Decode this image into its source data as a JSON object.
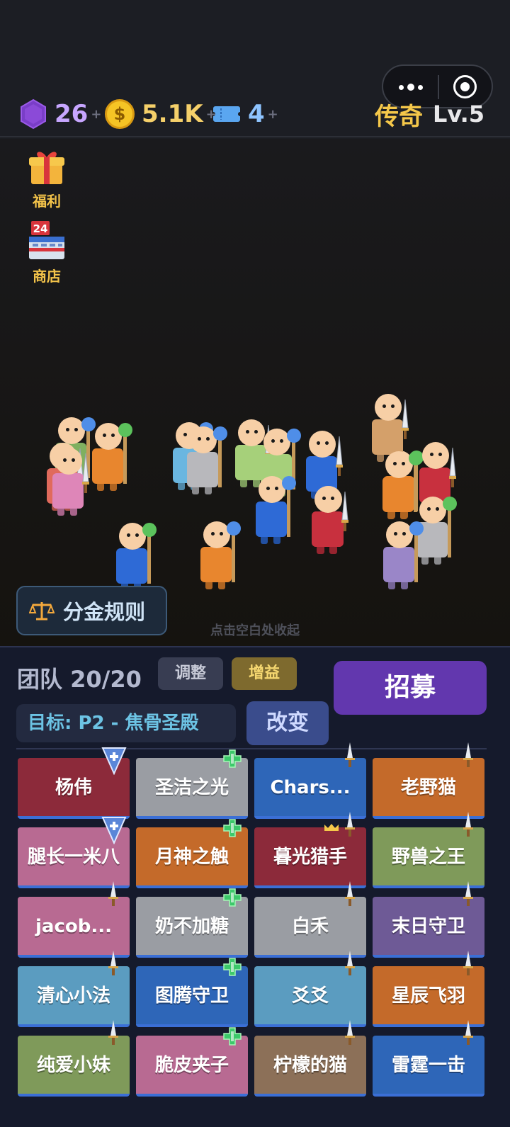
{
  "resources": {
    "gems": "26",
    "gold": "5.1K",
    "tickets": "4",
    "plus": "+"
  },
  "rank": {
    "name": "传奇",
    "level": "Lv.5"
  },
  "capsule": {
    "more_icon": "more-dots-icon",
    "close_icon": "target-circle-icon"
  },
  "side_buttons": {
    "welfare": "福利",
    "shop": "商店",
    "shop_badge": "24"
  },
  "rules_button": "分金规则",
  "hint": "点击空白处收起",
  "team": {
    "title": "团队 20/20",
    "adjust": "调整",
    "buff": "增益",
    "recruit": "招募",
    "target": "目标: P2 - 焦骨圣殿",
    "change": "改变"
  },
  "colors": {
    "red": "#8c2a3a",
    "gray": "#9a9da3",
    "blue": "#2e66b8",
    "orange": "#c46a2a",
    "pink": "#b86a92",
    "green": "#7f9a5a",
    "purple": "#6e5a96",
    "teal": "#5b9cc0",
    "brown": "#8c7058",
    "accent_purple": "#6237ae",
    "gold": "#f5c84a"
  },
  "roster": [
    {
      "name": "杨伟",
      "color": "#8c2a3a",
      "badge": "shield"
    },
    {
      "name": "圣洁之光",
      "color": "#9a9da3",
      "badge": "cross"
    },
    {
      "name": "Chars...",
      "color": "#2e66b8",
      "badge": "dagger"
    },
    {
      "name": "老野猫",
      "color": "#c46a2a",
      "badge": "dagger"
    },
    {
      "name": "腿长一米八",
      "color": "#b86a92",
      "badge": "shield"
    },
    {
      "name": "月神之触",
      "color": "#c46a2a",
      "badge": "cross"
    },
    {
      "name": "暮光猎手",
      "color": "#8c2a3a",
      "badge": "dagger-crown"
    },
    {
      "name": "野兽之王",
      "color": "#7f9a5a",
      "badge": "dagger"
    },
    {
      "name": "jacob...",
      "color": "#b86a92",
      "badge": "dagger"
    },
    {
      "name": "奶不加糖",
      "color": "#9a9da3",
      "badge": "cross"
    },
    {
      "name": "白禾",
      "color": "#9a9da3",
      "badge": "dagger"
    },
    {
      "name": "末日守卫",
      "color": "#6e5a96",
      "badge": "dagger"
    },
    {
      "name": "清心小法",
      "color": "#5b9cc0",
      "badge": "dagger"
    },
    {
      "name": "图腾守卫",
      "color": "#2e66b8",
      "badge": "cross"
    },
    {
      "name": "爻爻",
      "color": "#5b9cc0",
      "badge": "dagger"
    },
    {
      "name": "星辰飞羽",
      "color": "#c46a2a",
      "badge": "dagger"
    },
    {
      "name": "纯爱小妹",
      "color": "#7f9a5a",
      "badge": "dagger"
    },
    {
      "name": "脆皮夹子",
      "color": "#b86a92",
      "badge": "cross"
    },
    {
      "name": "柠檬的猫",
      "color": "#8c7058",
      "badge": "dagger"
    },
    {
      "name": "雷霆一击",
      "color": "#2e66b8",
      "badge": "dagger"
    }
  ],
  "units": [
    {
      "body": "#7fb060",
      "weapon": "staff",
      "orb": "#4f8ee8"
    },
    {
      "body": "#e06a5c",
      "weapon": "sword"
    },
    {
      "body": "#e8862e",
      "weapon": "staff",
      "orb": "#5cc25c"
    },
    {
      "body": "#de86b8",
      "weapon": "sword"
    },
    {
      "body": "#6ab6e0",
      "weapon": "staff",
      "orb": "#4f8ee8"
    },
    {
      "body": "#b8b8bc",
      "weapon": "staff",
      "orb": "#4f8ee8"
    },
    {
      "body": "#a6d07a",
      "weapon": "sword"
    },
    {
      "body": "#a6d07a",
      "weapon": "staff",
      "orb": "#4f8ee8"
    },
    {
      "body": "#e8862e",
      "weapon": "staff",
      "orb": "#5cc25c"
    },
    {
      "body": "#2e6ad6",
      "weapon": "sword"
    },
    {
      "body": "#d4a06a",
      "weapon": "sword"
    },
    {
      "body": "#e8862e",
      "weapon": "staff",
      "orb": "#5cc25c"
    },
    {
      "body": "#c8303e",
      "weapon": "sword"
    },
    {
      "body": "#2e6ad6",
      "weapon": "staff",
      "orb": "#4f8ee8"
    },
    {
      "body": "#c8303e",
      "weapon": "none"
    },
    {
      "body": "#b8b8bc",
      "weapon": "staff",
      "orb": "#5cc25c"
    },
    {
      "body": "#2e6ad6",
      "weapon": "staff",
      "orb": "#5cc25c"
    },
    {
      "body": "#e8862e",
      "weapon": "staff",
      "orb": "#4f8ee8"
    },
    {
      "body": "#9a86c8",
      "weapon": "staff",
      "orb": "#4f8ee8"
    },
    {
      "body": "#c8303e",
      "weapon": "sword"
    }
  ]
}
